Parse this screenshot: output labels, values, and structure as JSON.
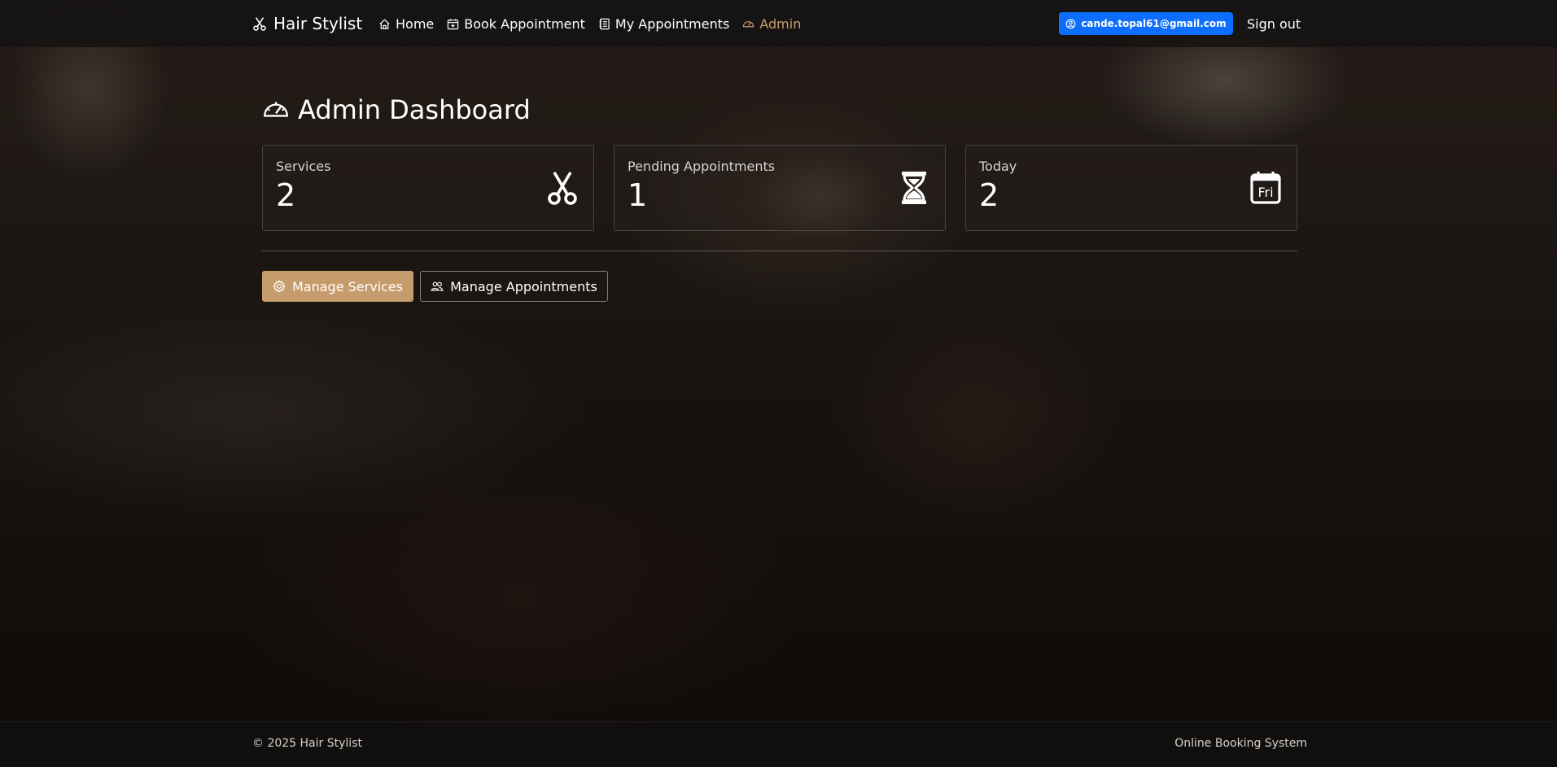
{
  "navbar": {
    "brand": "Hair Stylist",
    "links": [
      {
        "label": "Home",
        "icon": "home-icon",
        "active": false
      },
      {
        "label": "Book Appointment",
        "icon": "calendar-plus-icon",
        "active": false
      },
      {
        "label": "My Appointments",
        "icon": "journal-icon",
        "active": false
      },
      {
        "label": "Admin",
        "icon": "speedometer-icon",
        "active": true
      }
    ],
    "user_email": "cande.topal61@gmail.com",
    "signout_label": "Sign out"
  },
  "page": {
    "title": "Admin Dashboard"
  },
  "stats": [
    {
      "label": "Services",
      "value": "2",
      "icon": "scissors-icon"
    },
    {
      "label": "Pending Appointments",
      "value": "1",
      "icon": "hourglass-icon"
    },
    {
      "label": "Today",
      "value": "2",
      "icon": "calendar-day-icon",
      "icon_text": "Fri"
    }
  ],
  "actions": {
    "manage_services": "Manage Services",
    "manage_appointments": "Manage Appointments"
  },
  "footer": {
    "copyright": "© 2025 Hair Stylist",
    "tagline": "Online Booking System"
  },
  "colors": {
    "accent": "#c69c6d",
    "active_nav": "#c79d6f",
    "user_badge": "#0d6efd"
  }
}
